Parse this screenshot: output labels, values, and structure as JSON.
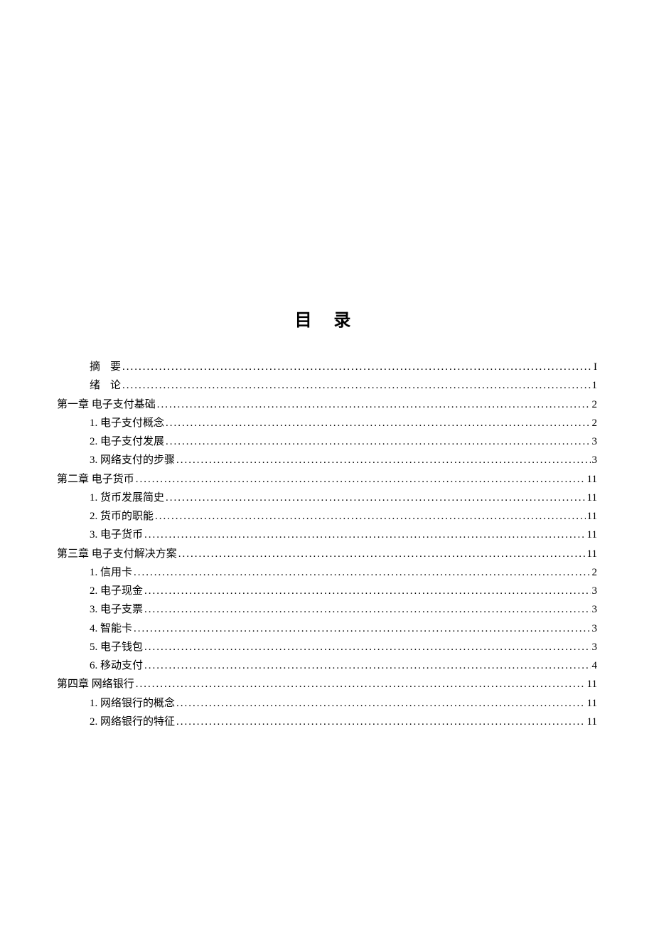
{
  "title": "目 录",
  "entries": [
    {
      "label": "摘",
      "label2": "要",
      "page": "I",
      "indent": 1,
      "spaced": true
    },
    {
      "label": "绪",
      "label2": "论",
      "page": "1",
      "indent": 1,
      "spaced": true
    },
    {
      "label": "第一章 电子支付基础",
      "page": "2",
      "indent": 0
    },
    {
      "label": "1. 电子支付概念",
      "page": "2",
      "indent": 2
    },
    {
      "label": "2. 电子支付发展",
      "page": "3",
      "indent": 2
    },
    {
      "label": "3. 网络支付的步骤",
      "page": "3",
      "indent": 2
    },
    {
      "label": "第二章 电子货币",
      "page": "11",
      "indent": 0
    },
    {
      "label": "1. 货币发展简史",
      "page": "11",
      "indent": 2
    },
    {
      "label": "2. 货币的职能",
      "page": "11",
      "indent": 2
    },
    {
      "label": "3. 电子货币",
      "page": "11",
      "indent": 2
    },
    {
      "label": "第三章 电子支付解决方案",
      "page": "11",
      "indent": 0
    },
    {
      "label": "1. 信用卡",
      "page": "2",
      "indent": 2
    },
    {
      "label": "2. 电子现金",
      "page": "3",
      "indent": 2
    },
    {
      "label": "3. 电子支票",
      "page": "3",
      "indent": 2
    },
    {
      "label": "4. 智能卡",
      "page": "3",
      "indent": 2
    },
    {
      "label": "5. 电子钱包",
      "page": "3",
      "indent": 2
    },
    {
      "label": "6. 移动支付",
      "page": "4",
      "indent": 2
    },
    {
      "label": "第四章 网络银行",
      "page": "11",
      "indent": 0
    },
    {
      "label": "1. 网络银行的概念",
      "page": "11",
      "indent": 2
    },
    {
      "label": "2. 网络银行的特征",
      "page": "11",
      "indent": 2
    }
  ]
}
